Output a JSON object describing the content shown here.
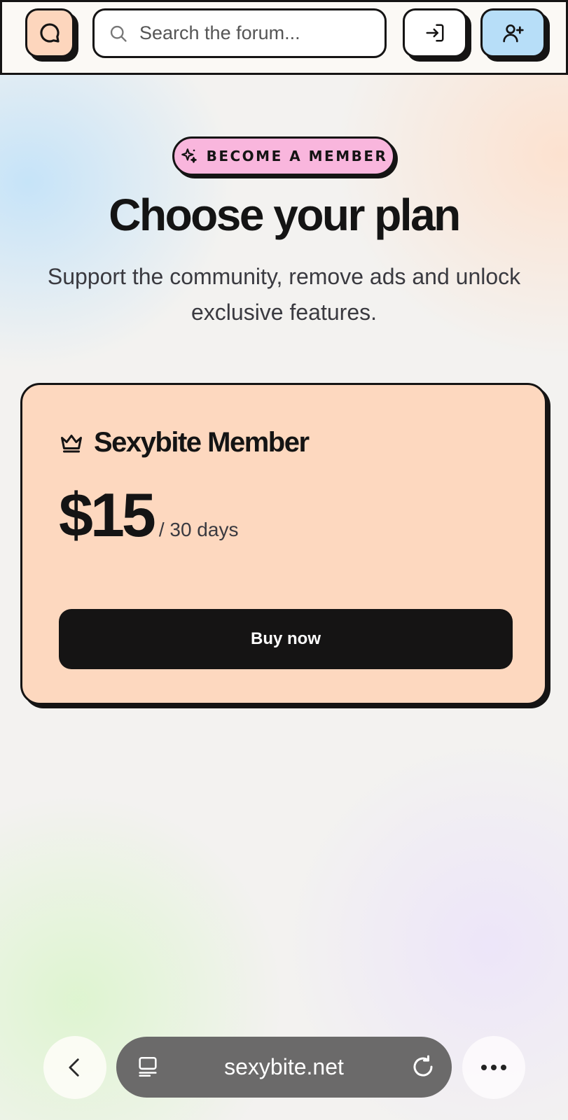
{
  "header": {
    "logo_icon": "chat-bubble-icon",
    "search": {
      "placeholder": "Search the forum...",
      "value": ""
    },
    "login_icon": "login-arrow-icon",
    "signup_icon": "user-plus-icon"
  },
  "hero": {
    "badge": "BECOME A MEMBER",
    "badge_icon": "sparkles-icon",
    "title": "Choose your plan",
    "subtitle": "Support the community, remove ads and unlock exclusive features."
  },
  "plan": {
    "icon": "crown-icon",
    "name": "Sexybite Member",
    "price": "$15",
    "period": "/ 30 days",
    "cta": "Buy now"
  },
  "browser": {
    "url": "sexybite.net",
    "back_icon": "chevron-left-icon",
    "tabs_icon": "tabs-icon",
    "reload_icon": "reload-icon",
    "more_icon": "more-dots-icon"
  },
  "colors": {
    "ink": "#151414",
    "logo_bg": "#fdd6bd",
    "signup_bg": "#b7def8",
    "badge_bg": "#f9b6dd",
    "card_bg": "#fdd8bf",
    "url_bar_bg": "#6b6a6a"
  }
}
